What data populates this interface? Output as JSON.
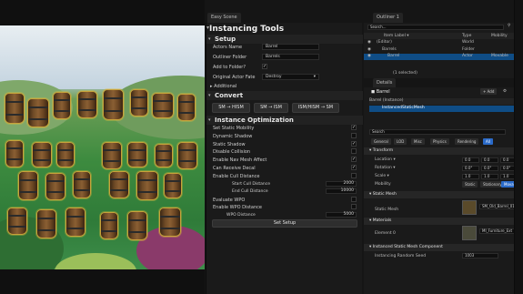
{
  "tools_tab": "Easy Scene",
  "tools": {
    "title": "Instancing Tools",
    "setup": {
      "header": "Setup",
      "actors_name_label": "Actors Name",
      "actors_name_value": "Barrel",
      "outliner_folder_label": "Outliner Folder",
      "outliner_folder_value": "Barrels",
      "add_to_folder_label": "Add to Folder?",
      "original_actor_fate_label": "Original Actor Fate",
      "original_actor_fate_value": "Destroy",
      "additional_label": "Additional"
    },
    "convert": {
      "header": "Convert",
      "btn1": "SM → HISM",
      "btn2": "SM → ISM",
      "btn3": "ISM/HISM → SM"
    },
    "optimization": {
      "header": "Instance Optimization",
      "items": [
        {
          "label": "Set Static Mobility",
          "checked": true
        },
        {
          "label": "Dynamic Shadow",
          "checked": false
        },
        {
          "label": "Static Shadow",
          "checked": true
        },
        {
          "label": "Disable Collision",
          "checked": false
        },
        {
          "label": "Enable Nav Mesh Affect",
          "checked": true
        },
        {
          "label": "Can Receive Decal",
          "checked": true
        },
        {
          "label": "Enable Cull Distance",
          "checked": false
        }
      ],
      "start_cull_label": "Start Cull Distance",
      "start_cull_value": "2000",
      "end_cull_label": "End Cull Distance",
      "end_cull_value": "10000",
      "evaluate_wpo_label": "Evaluate WPO",
      "enable_wpo_distance_label": "Enable WPO Distance",
      "wpo_distance_label": "WPO Distance",
      "wpo_distance_value": "5000",
      "setup_button": "Set Setup"
    }
  },
  "outliner": {
    "tab": "Outliner 1",
    "search_placeholder": "Search...",
    "col_item": "Item Label ▾",
    "col_type": "Type",
    "col_mobility": "Mobility",
    "rows": [
      {
        "label": "(Editor)",
        "type": "World",
        "mobility": ""
      },
      {
        "label": "Barrels",
        "type": "Folder",
        "mobility": ""
      },
      {
        "label": "Barrel",
        "type": "Actor",
        "mobility": "Movable"
      }
    ],
    "footer": "1 selected"
  },
  "details": {
    "tab": "Details",
    "actor_name": "Barrel",
    "add_button": "+ Add",
    "instance_row": "Barrel (Instance)",
    "component_row": "InstancedStaticMesh",
    "search_placeholder": "Search",
    "filters": [
      "General",
      "LOD",
      "Misc",
      "Physics",
      "Rendering",
      "All"
    ],
    "transform_header": "Transform",
    "location_label": "Location",
    "location": [
      "0.0",
      "0.0",
      "0.0"
    ],
    "rotation_label": "Rotation",
    "rotation": [
      "0.0°",
      "0.0°",
      "0.0°"
    ],
    "scale_label": "Scale",
    "scale": [
      "1.0",
      "1.0",
      "1.0"
    ],
    "mobility_label": "Mobility",
    "mobility_options": [
      "Static",
      "Stationary",
      "Movable"
    ],
    "static_mesh_header": "Static Mesh",
    "static_mesh_label": "Static Mesh",
    "static_mesh_value": "SM_Old_Barrel_01",
    "materials_header": "Materials",
    "element_label": "Element 0",
    "element_value": "MI_Furniture_Ext",
    "ism_header": "Instanced Static Mesh Component",
    "random_seed_label": "Instancing Random Seed",
    "random_seed_value": "1003",
    "accent": "#2a6ac8",
    "selection": "#0f4d86"
  }
}
